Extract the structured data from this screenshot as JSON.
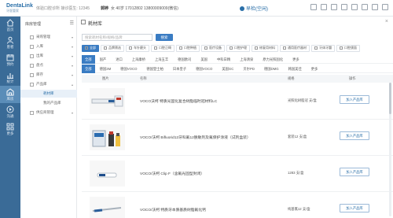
{
  "colors": {
    "sidebar": "#3a6b97",
    "sidebar_active": "#5b8db8",
    "accent": "#3a7cc3"
  },
  "topbar": {
    "logo_main": "DentaLink",
    "logo_sub": "牙医管家",
    "clinic_info": "体验口腔诊所  接诊医生: 12345",
    "patient_name": "郭婷",
    "patient_info": "女  40岁  17012802  13800009009(微信)",
    "status_label": "早检(空闲)"
  },
  "sidebar": {
    "items": [
      {
        "label": "首页",
        "icon": "home-icon"
      },
      {
        "label": "患者",
        "icon": "person-icon"
      },
      {
        "label": "预约",
        "icon": "calendar-icon"
      },
      {
        "label": "统计",
        "icon": "chart-icon"
      },
      {
        "label": "库房",
        "icon": "warehouse-icon"
      },
      {
        "label": "沟通",
        "icon": "play-icon"
      },
      {
        "label": "更多",
        "icon": "more-icon"
      }
    ]
  },
  "tree": {
    "title": "库房管理",
    "items": [
      {
        "label": "采购管理"
      },
      {
        "label": "入库"
      },
      {
        "label": "出库"
      },
      {
        "label": "盘点"
      },
      {
        "label": "库存"
      },
      {
        "label": "产品库"
      },
      {
        "label": "耗材库"
      },
      {
        "label": "我的产品库"
      },
      {
        "label": "供应商管理"
      }
    ]
  },
  "page": {
    "title": "耗材库"
  },
  "search": {
    "placeholder": "搜索耗材名称/规格/品牌",
    "button": "搜索"
  },
  "filters": [
    {
      "label": "全部"
    },
    {
      "label": "品牌筛选"
    },
    {
      "label": "车针磨头"
    },
    {
      "label": "口腔正畸"
    },
    {
      "label": "口腔种植"
    },
    {
      "label": "医疗设备"
    },
    {
      "label": "口腔护理"
    },
    {
      "label": "修复用材料"
    },
    {
      "label": "通用医疗器材"
    },
    {
      "label": "牙体牙髓"
    },
    {
      "label": "口腔颌面"
    }
  ],
  "brands_row1": [
    {
      "label": "全部"
    },
    {
      "label": "国产"
    },
    {
      "label": "进口"
    },
    {
      "label": "上海康桥"
    },
    {
      "label": "上海五丰"
    },
    {
      "label": "德国欧司"
    },
    {
      "label": "美国"
    },
    {
      "label": "中科日精"
    },
    {
      "label": "上海清泉"
    },
    {
      "label": "原力光照固化"
    },
    {
      "label": "更多"
    }
  ],
  "brands_row2": [
    {
      "label": "全部"
    },
    {
      "label": "德国3M"
    },
    {
      "label": "德国VOCO"
    },
    {
      "label": "德国登士柏"
    },
    {
      "label": "日本皇子"
    },
    {
      "label": "德国VOCO"
    },
    {
      "label": "美国GC"
    },
    {
      "label": "贝尔PD"
    },
    {
      "label": "德国DMG"
    },
    {
      "label": "韩国美佳"
    },
    {
      "label": "更多"
    }
  ],
  "table": {
    "headers": [
      "图片",
      "名称",
      "规格",
      "操作"
    ],
    "rows": [
      {
        "name": "VOCO沃柯  特质光固化复合树脂临时冠材料LC",
        "spec": "光照化树脂冠  支/盒",
        "add": "加入产品库"
      },
      {
        "name": "VOCO/沃柯 Bifluorid12牙科氟12脱敏剂及氟保护涂液（试剂盒装）",
        "spec": "套装12  支/盒",
        "add": "加入产品库"
      },
      {
        "name": "VOCO/沃柯 Clip F（含氟光固型封闭）",
        "spec": "1283  支/盒",
        "add": "加入产品库"
      },
      {
        "name": "VOCO/沃柯 特质牙本质基质树脂氟化钙",
        "spec": "纯基氯12  支/盒",
        "add": "加入产品库"
      }
    ]
  }
}
